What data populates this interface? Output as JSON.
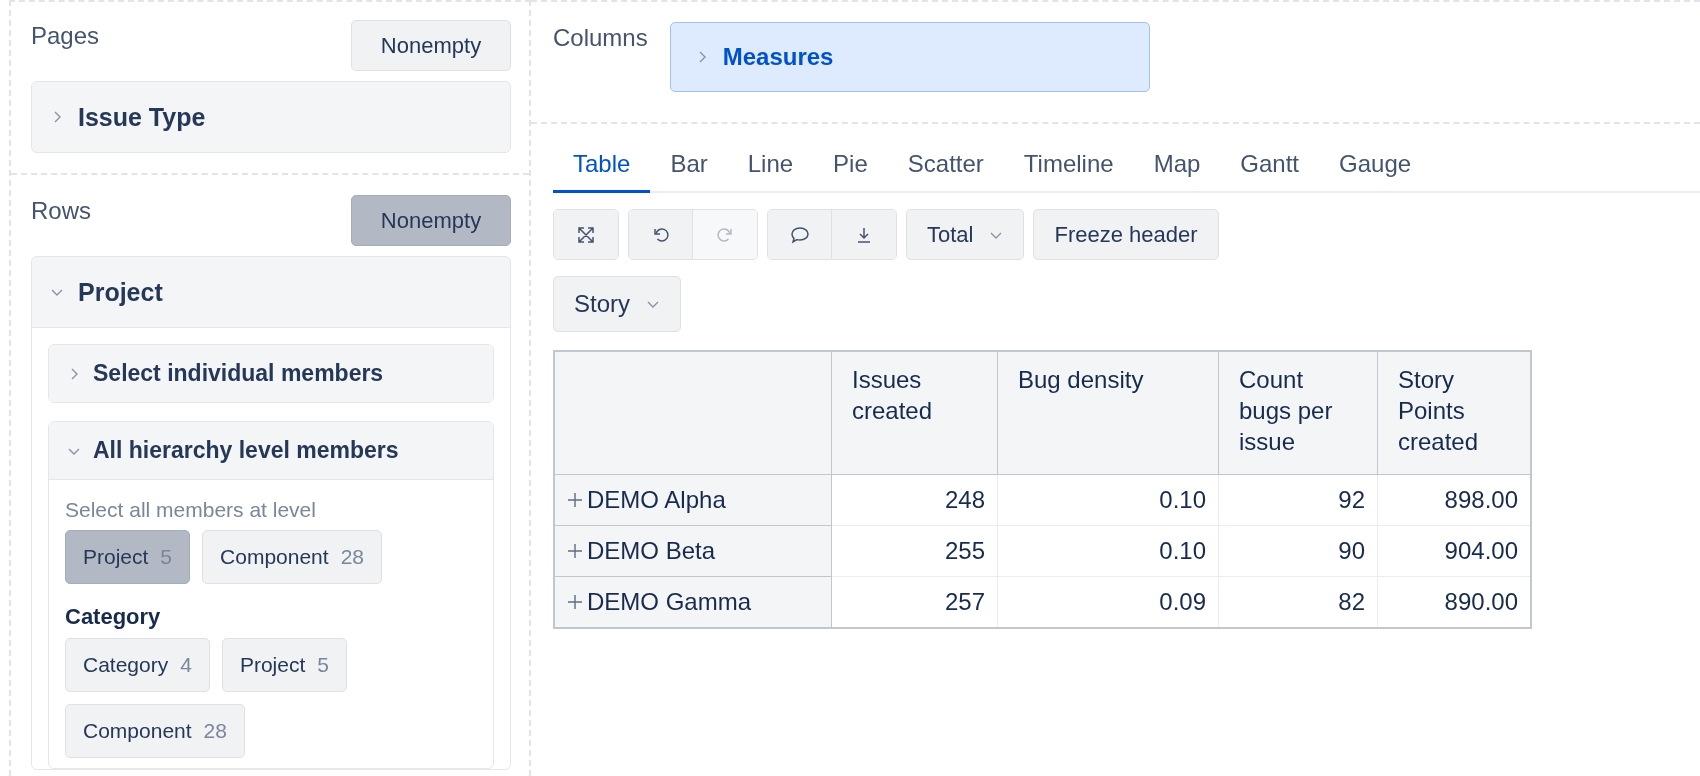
{
  "pages": {
    "title": "Pages",
    "nonempty": {
      "label": "Nonempty",
      "selected": false
    },
    "items": [
      {
        "label": "Issue Type",
        "expanded": false
      }
    ]
  },
  "rows": {
    "title": "Rows",
    "nonempty": {
      "label": "Nonempty",
      "selected": true
    },
    "dimension": {
      "label": "Project",
      "expanded": true,
      "sections": [
        {
          "label": "Select individual members",
          "expanded": false
        },
        {
          "label": "All hierarchy level members",
          "expanded": true,
          "hint": "Select all members at level",
          "levels": [
            {
              "label": "Project",
              "count": "5",
              "selected": true
            },
            {
              "label": "Component",
              "count": "28",
              "selected": false
            }
          ],
          "groups": [
            {
              "title": "Category",
              "levels": [
                {
                  "label": "Category",
                  "count": "4",
                  "selected": false
                },
                {
                  "label": "Project",
                  "count": "5",
                  "selected": false
                },
                {
                  "label": "Component",
                  "count": "28",
                  "selected": false
                }
              ]
            }
          ]
        }
      ]
    }
  },
  "columns": {
    "title": "Columns",
    "items": [
      {
        "label": "Measures",
        "expanded": false
      }
    ]
  },
  "tabs": [
    {
      "label": "Table",
      "selected": true
    },
    {
      "label": "Bar",
      "selected": false
    },
    {
      "label": "Line",
      "selected": false
    },
    {
      "label": "Pie",
      "selected": false
    },
    {
      "label": "Scatter",
      "selected": false
    },
    {
      "label": "Timeline",
      "selected": false
    },
    {
      "label": "Map",
      "selected": false
    },
    {
      "label": "Gantt",
      "selected": false
    },
    {
      "label": "Gauge",
      "selected": false
    }
  ],
  "toolbar": {
    "groups": [
      [
        {
          "kind": "fullscreen",
          "disabled": false
        }
      ],
      [
        {
          "kind": "undo",
          "disabled": false
        },
        {
          "kind": "redo",
          "disabled": true
        }
      ],
      [
        {
          "kind": "comment",
          "disabled": false
        },
        {
          "kind": "download",
          "disabled": false
        }
      ]
    ],
    "total": "Total",
    "freeze": "Freeze header",
    "story": "Story"
  },
  "table": {
    "columns": [
      "",
      "Issues created",
      "Bug density",
      "Count bugs per issue",
      "Story Points created"
    ],
    "rows": [
      {
        "cells": [
          "DEMO Alpha",
          "248",
          "0.10",
          "92",
          "898.00"
        ]
      },
      {
        "cells": [
          "DEMO Beta",
          "255",
          "0.10",
          "90",
          "904.00"
        ]
      },
      {
        "cells": [
          "DEMO Gamma",
          "257",
          "0.09",
          "82",
          "890.00"
        ]
      }
    ]
  }
}
